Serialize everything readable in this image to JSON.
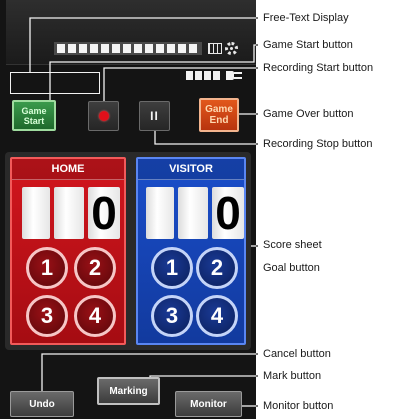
{
  "app": {
    "free_text": "",
    "icons": {
      "settings": "settings-icon",
      "battery": "battery-icon",
      "plug": "plug-icon"
    }
  },
  "controls": {
    "game_start": {
      "line1": "Game",
      "line2": "Start",
      "color": "#2b7d3a"
    },
    "recording_start": {
      "icon": "record-icon",
      "color": "#e0101a"
    },
    "recording_stop": {
      "icon": "pause-icon",
      "symbol": "II"
    },
    "game_end": {
      "line1": "Game",
      "line2": "End",
      "color": "#cf4a16"
    }
  },
  "scoreboard": {
    "home": {
      "label": "HOME",
      "score": "0",
      "goals": [
        "1",
        "2",
        "3",
        "4"
      ],
      "color": "#d3161e"
    },
    "visitor": {
      "label": "VISITOR",
      "score": "0",
      "goals": [
        "1",
        "2",
        "3",
        "4"
      ],
      "color": "#1a4ecb"
    }
  },
  "bottom_bar": {
    "undo": "Undo",
    "marking": "Marking",
    "monitor": "Monitor"
  },
  "callouts": {
    "free_text_display": "Free-Text Display",
    "game_start": "Game Start button",
    "recording_start": "Recording Start button",
    "game_over": "Game Over button",
    "recording_stop": "Recording Stop button",
    "score_sheet": "Score sheet",
    "goal": "Goal button",
    "cancel": "Cancel button",
    "mark": "Mark button",
    "monitor": "Monitor button"
  }
}
